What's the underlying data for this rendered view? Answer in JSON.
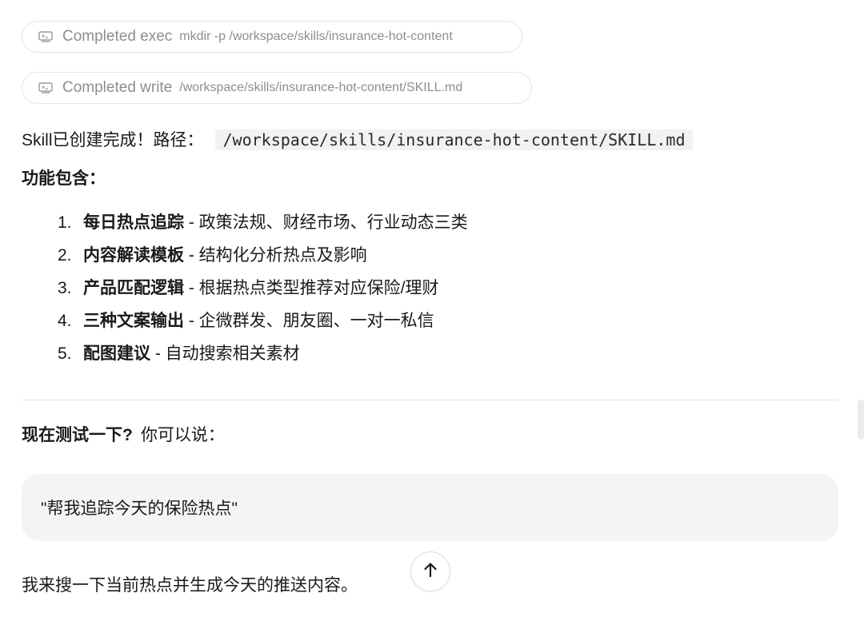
{
  "tool_calls": [
    {
      "status": "Completed exec",
      "detail": "mkdir -p /workspace/skills/insurance-hot-content",
      "icon": "terminal-icon"
    },
    {
      "status": "Completed write",
      "detail": "/workspace/skills/insurance-hot-content/SKILL.md",
      "icon": "terminal-icon"
    }
  ],
  "message": {
    "intro_text": "Skill已创建完成！路径：",
    "intro_path": "/workspace/skills/insurance-hot-content/SKILL.md",
    "features_heading": "功能包含：",
    "features": [
      {
        "num": "1.",
        "title": "每日热点追踪",
        "desc": " - 政策法规、财经市场、行业动态三类"
      },
      {
        "num": "2.",
        "title": "内容解读模板",
        "desc": " - 结构化分析热点及影响"
      },
      {
        "num": "3.",
        "title": "产品匹配逻辑",
        "desc": " - 根据热点类型推荐对应保险/理财"
      },
      {
        "num": "4.",
        "title": "三种文案输出",
        "desc": " - 企微群发、朋友圈、一对一私信"
      },
      {
        "num": "5.",
        "title": "配图建议",
        "desc": " - 自动搜索相关素材"
      }
    ],
    "test_bold": "现在测试一下?",
    "test_rest": "你可以说：",
    "quote": "\"帮我追踪今天的保险热点\"",
    "closing": "我来搜一下当前热点并生成今天的推送内容。"
  },
  "controls": {
    "scroll_icon": "arrow-up-icon"
  },
  "colors": {
    "muted_text": "#8e8e8e",
    "quote_bg": "#f4f4f4",
    "code_bg": "#f2f2f2"
  }
}
